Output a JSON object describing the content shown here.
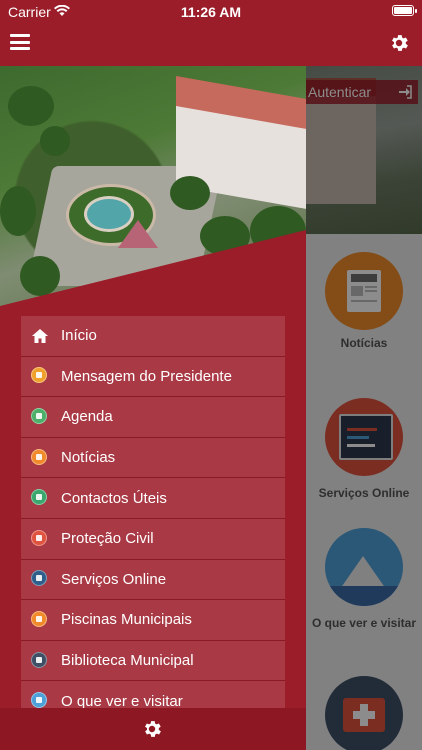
{
  "status": {
    "carrier": "Carrier",
    "time": "11:26 AM"
  },
  "navbar": {
    "menu_icon": "hamburger-icon",
    "settings_icon": "gear-icon",
    "color": "#9b1d2a"
  },
  "background": {
    "auth_label": "Autenticar",
    "tiles": [
      {
        "label": "Notícias",
        "icon": "newspaper-icon"
      },
      {
        "label": "Serviços Online",
        "icon": "browser-code-icon"
      },
      {
        "label": "O que ver e visitar",
        "icon": "mountain-icon"
      },
      {
        "label": "",
        "icon": "first-aid-icon"
      }
    ]
  },
  "drawer": {
    "menu": [
      {
        "label": "Início",
        "icon": "home-icon",
        "color": "#ffffff"
      },
      {
        "label": "Mensagem do Presidente",
        "icon": "message-icon",
        "color": "#f0a12b"
      },
      {
        "label": "Agenda",
        "icon": "calendar-icon",
        "color": "#4caf6a"
      },
      {
        "label": "Notícias",
        "icon": "newspaper-icon",
        "color": "#f08a2b"
      },
      {
        "label": "Contactos Úteis",
        "icon": "phone-icon",
        "color": "#3aa76d"
      },
      {
        "label": "Proteção Civil",
        "icon": "shield-icon",
        "color": "#e0533f"
      },
      {
        "label": "Serviços Online",
        "icon": "browser-icon",
        "color": "#2f5f8a"
      },
      {
        "label": "Piscinas Municipais",
        "icon": "pool-icon",
        "color": "#f08a2b"
      },
      {
        "label": "Biblioteca Municipal",
        "icon": "library-icon",
        "color": "#3f4f66"
      },
      {
        "label": "O que ver e visitar",
        "icon": "mountain-icon",
        "color": "#4ea0d8"
      }
    ],
    "footer_icon": "gear-icon"
  }
}
